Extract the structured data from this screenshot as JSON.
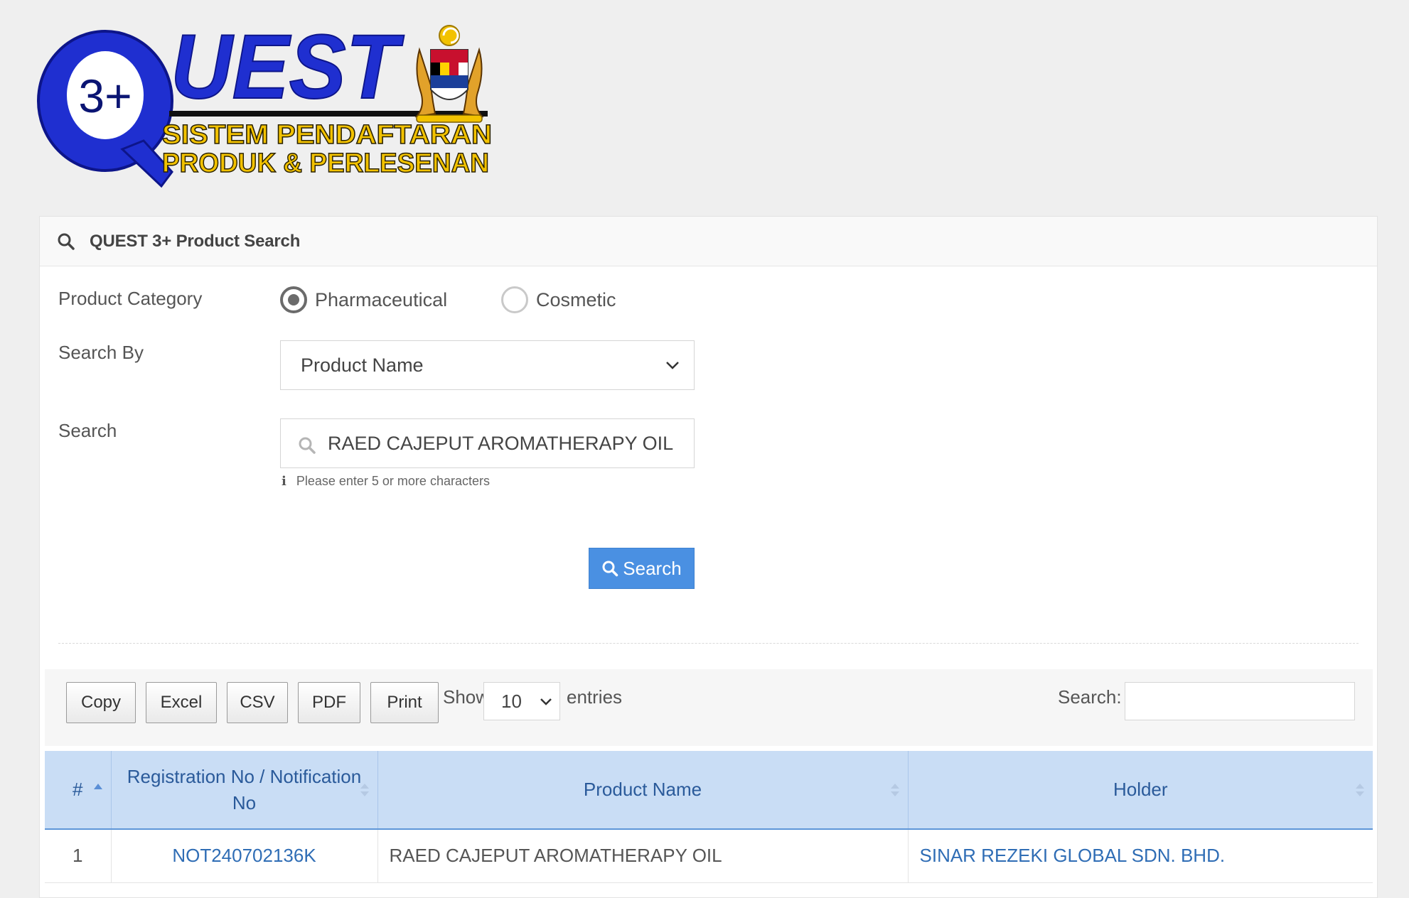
{
  "logo": {
    "big_text": "QUEST",
    "badge": "3+",
    "line1": "SISTEM PENDAFTARAN",
    "line2": "PRODUK & PERLESENAN"
  },
  "panel": {
    "title": "QUEST 3+ Product Search"
  },
  "form": {
    "category_label": "Product Category",
    "category_options": [
      "Pharmaceutical",
      "Cosmetic"
    ],
    "category_selected": "Pharmaceutical",
    "search_by_label": "Search By",
    "search_by_value": "Product Name",
    "search_label": "Search",
    "search_value": "RAED CAJEPUT AROMATHERAPY OIL",
    "hint": "Please enter 5 or more characters",
    "search_button": "Search"
  },
  "toolbar": {
    "buttons": [
      "Copy",
      "Excel",
      "CSV",
      "PDF",
      "Print"
    ],
    "show_label": "Show",
    "length_value": "10",
    "entries_label": "entries",
    "filter_label": "Search:"
  },
  "table": {
    "headers": [
      "#",
      "Registration No / Notification No",
      "Product Name",
      "Holder"
    ],
    "rows": [
      {
        "num": "1",
        "reg_no": "NOT240702136K",
        "product": "RAED CAJEPUT AROMATHERAPY OIL",
        "holder": "SINAR REZEKI GLOBAL SDN. BHD."
      }
    ]
  },
  "colors": {
    "primary_button": "#4a90e2",
    "table_header_bg": "#c9ddf5",
    "link": "#2f6db5",
    "logo_blue": "#1f2fd0",
    "logo_gold": "#f2c200"
  }
}
